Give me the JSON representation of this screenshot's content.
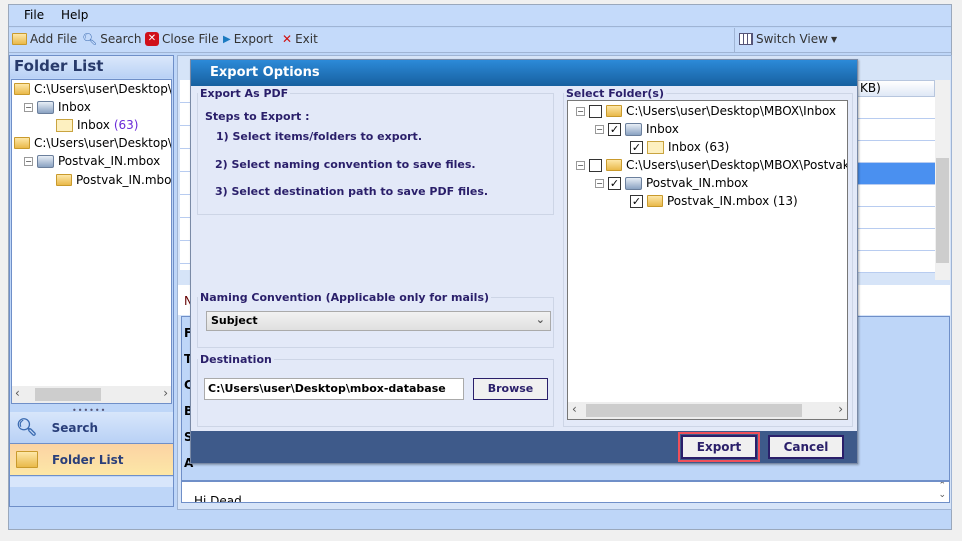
{
  "menu": {
    "file": "File",
    "help": "Help"
  },
  "toolbar": {
    "add_file": "Add File",
    "search": "Search",
    "close_file": "Close File",
    "export": "Export",
    "exit": "Exit",
    "switch_view": "Switch View"
  },
  "left_panel": {
    "title": "Folder List",
    "tree": [
      {
        "label": "C:\\Users\\user\\Desktop\\M"
      },
      {
        "label": "Inbox"
      },
      {
        "label": "Inbox",
        "count": "(63)"
      },
      {
        "label": "C:\\Users\\user\\Desktop\\M"
      },
      {
        "label": "Postvak_IN.mbox"
      },
      {
        "label": "Postvak_IN.mbox"
      }
    ],
    "nav": {
      "search": "Search",
      "folder_list": "Folder List"
    }
  },
  "background": {
    "column_header_fragment": "KB)",
    "preview_letters": [
      "N",
      "F",
      "T",
      "C",
      "B",
      "S",
      "A"
    ],
    "body_fragment": "Hi Dead"
  },
  "dialog": {
    "title": "Export Options",
    "export_group": "Export As PDF",
    "steps_title": "Steps to Export :",
    "steps": [
      "1) Select items/folders to export.",
      "2) Select naming convention to save files.",
      "3) Select destination path to save PDF files."
    ],
    "naming_group": "Naming Convention (Applicable only for mails)",
    "naming_value": "Subject",
    "destination_group": "Destination",
    "destination_value": "C:\\Users\\user\\Desktop\\mbox-database",
    "browse": "Browse",
    "folders_group": "Select Folder(s)",
    "folders": [
      {
        "label": "C:\\Users\\user\\Desktop\\MBOX\\Inbox",
        "checked": false
      },
      {
        "label": "Inbox",
        "checked": true
      },
      {
        "label": "Inbox (63)",
        "checked": true
      },
      {
        "label": "C:\\Users\\user\\Desktop\\MBOX\\Postvak_IN",
        "checked": false
      },
      {
        "label": "Postvak_IN.mbox",
        "checked": true
      },
      {
        "label": "Postvak_IN.mbox (13)",
        "checked": true
      }
    ],
    "export_button": "Export",
    "cancel_button": "Cancel"
  },
  "colors": {
    "title_bar": "#2080cc",
    "footer": "#3e5a8a",
    "highlight": "#f0505a",
    "selected_row": "#4a90f0"
  }
}
